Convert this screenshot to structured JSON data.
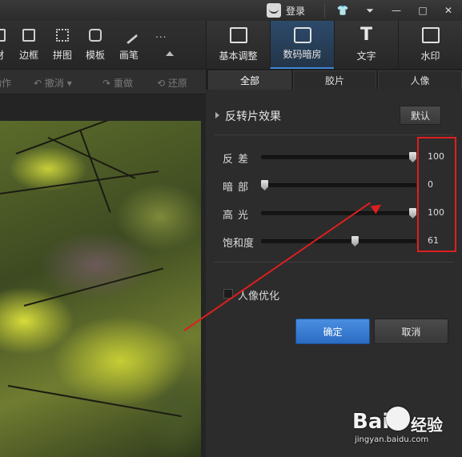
{
  "titlebar": {
    "login_label": "登录",
    "window_buttons": [
      "shirt-icon",
      "menu-icon",
      "minimize-icon",
      "maximize-icon",
      "close-icon"
    ]
  },
  "toolbar": {
    "items": [
      {
        "label": "材",
        "icon": "material-icon"
      },
      {
        "label": "边框",
        "icon": "frame-icon"
      },
      {
        "label": "拼图",
        "icon": "collage-icon"
      },
      {
        "label": "模板",
        "icon": "template-icon"
      },
      {
        "label": "画笔",
        "icon": "brush-icon"
      }
    ],
    "more_label": "..."
  },
  "undo_row": {
    "action_label": "动作",
    "undo_label": "撤消",
    "redo_label": "重做",
    "restore_label": "还原"
  },
  "right_tabs": [
    {
      "label": "基本调整",
      "icon": "edit-icon",
      "active": false
    },
    {
      "label": "数码暗房",
      "icon": "camera-icon",
      "active": true
    },
    {
      "label": "文字",
      "icon": "text-icon",
      "active": false
    },
    {
      "label": "水印",
      "icon": "watermark-icon",
      "active": false
    }
  ],
  "sub_tabs": [
    {
      "label": "全部",
      "active": true
    },
    {
      "label": "胶片",
      "active": false
    },
    {
      "label": "人像",
      "active": false
    }
  ],
  "effect": {
    "title": "反转片效果",
    "default_button": "默认"
  },
  "sliders": [
    {
      "label": "反差",
      "value": 100,
      "display": "100"
    },
    {
      "label": "暗部",
      "value": 0,
      "display": "0"
    },
    {
      "label": "高光",
      "value": 100,
      "display": "100"
    },
    {
      "label": "饱和度",
      "value": 61,
      "display": "61"
    }
  ],
  "portrait_opt": {
    "label": "人像优化",
    "checked": false
  },
  "buttons": {
    "ok": "确定",
    "cancel": "取消"
  },
  "watermark": {
    "brand": "Bai",
    "brand2": "经验",
    "url": "jingyan.baidu.com"
  },
  "colors": {
    "accent": "#3f86d6",
    "annotation": "#e01e1e"
  }
}
